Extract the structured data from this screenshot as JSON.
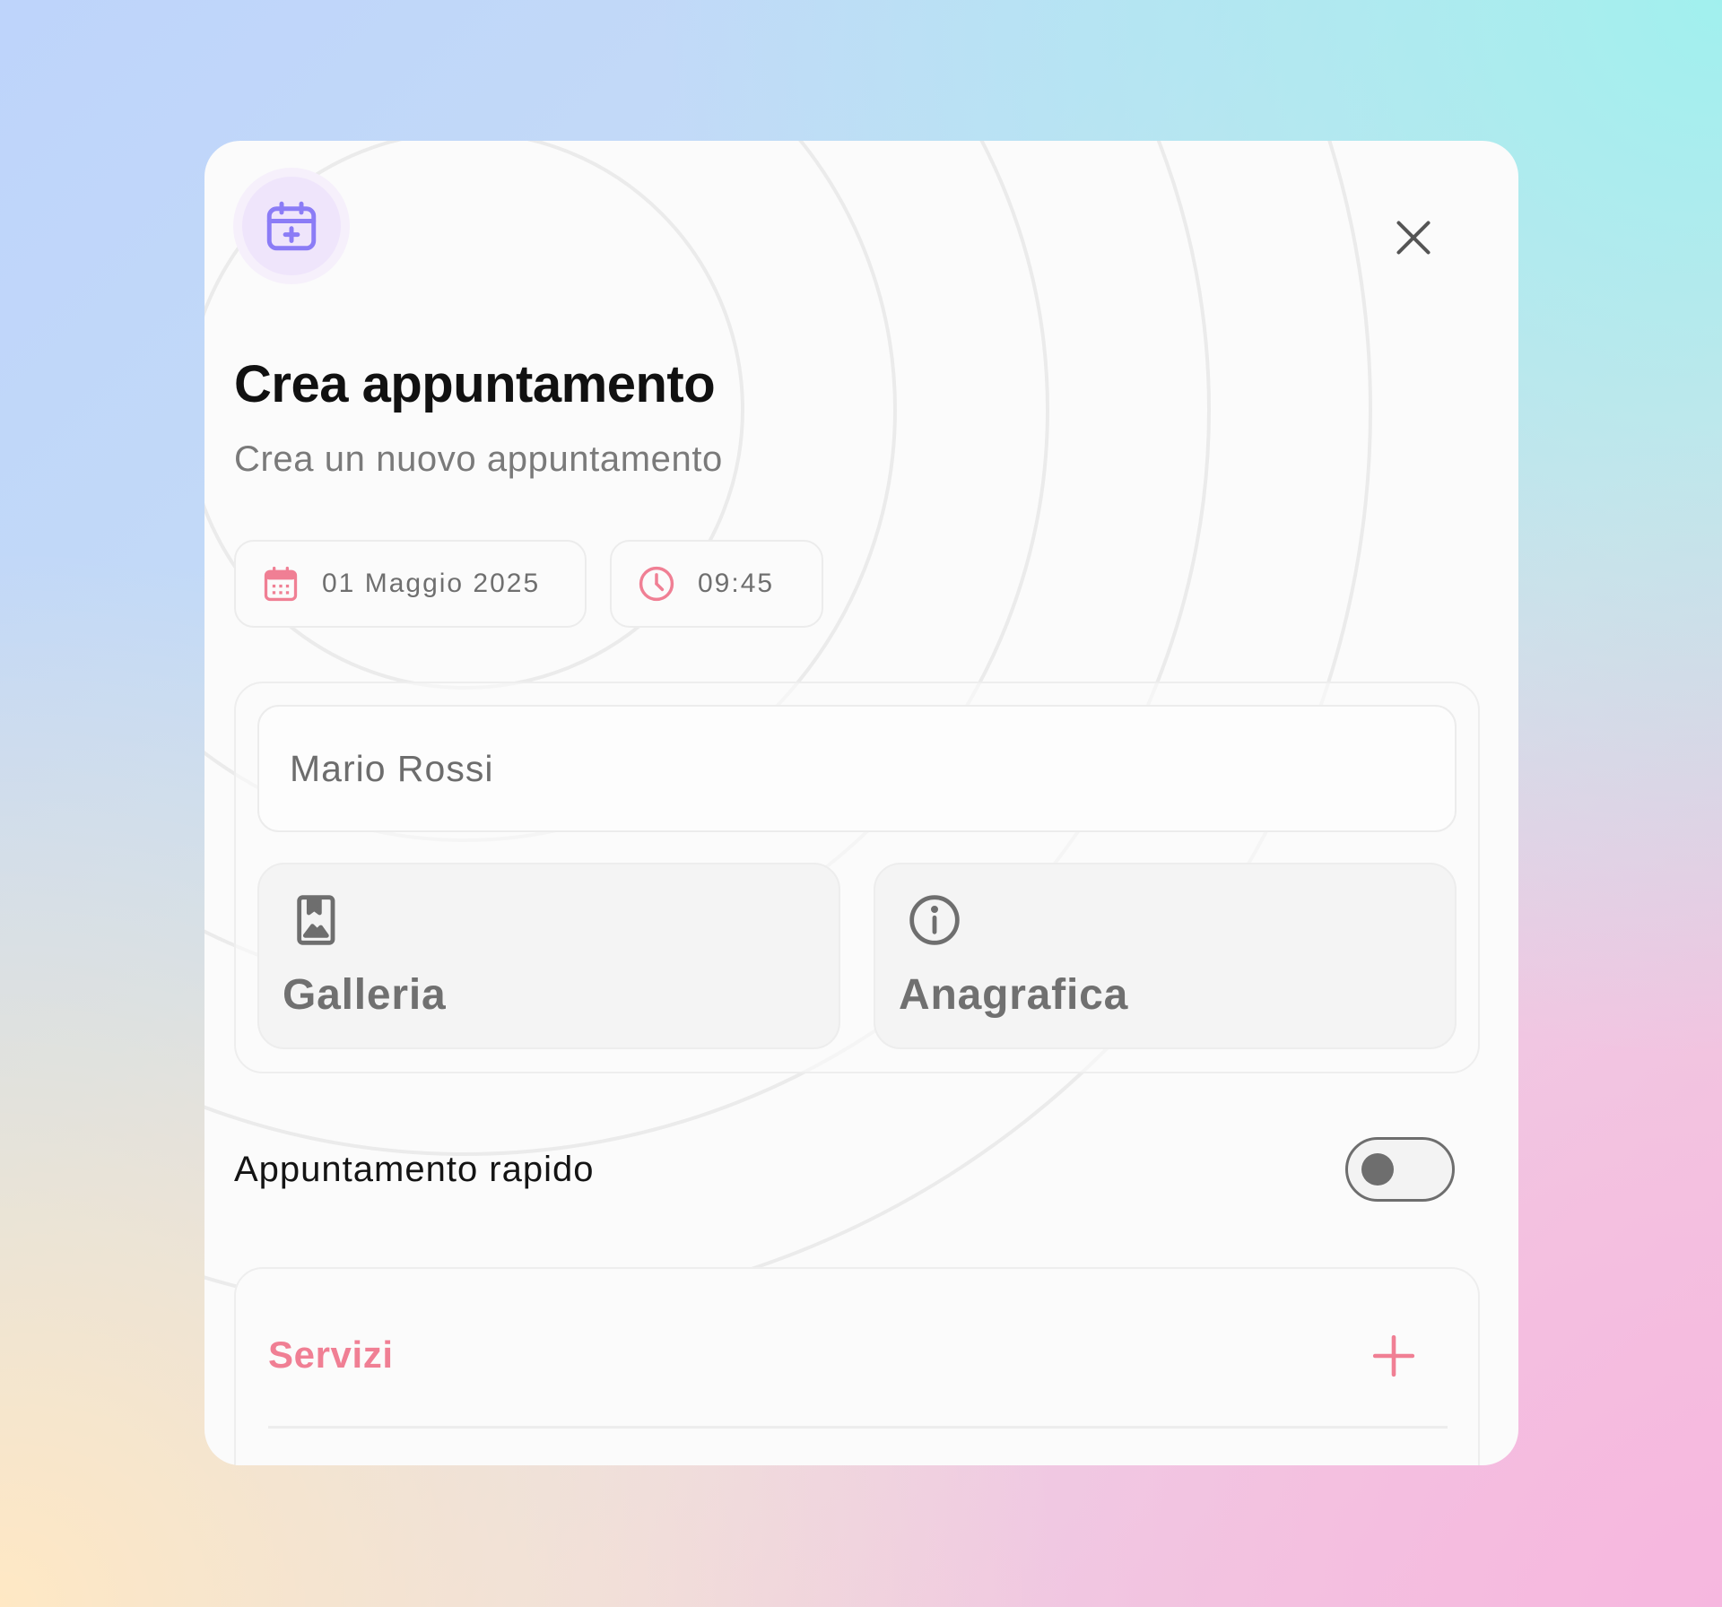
{
  "dialog": {
    "title": "Crea appuntamento",
    "subtitle": "Crea un nuovo appuntamento",
    "header_icon": "calendar-plus-icon",
    "close_icon": "close-icon"
  },
  "schedule": {
    "date": "01 Maggio 2025",
    "date_icon": "calendar-icon",
    "time": "09:45",
    "time_icon": "clock-icon"
  },
  "client": {
    "name": "Mario Rossi",
    "tiles": [
      {
        "label": "Galleria",
        "icon": "gallery-icon"
      },
      {
        "label": "Anagrafica",
        "icon": "info-icon"
      }
    ]
  },
  "quick_appointment": {
    "label": "Appuntamento rapido",
    "enabled": false
  },
  "services": {
    "label": "Servizi",
    "add_icon": "plus-icon"
  },
  "colors": {
    "accent_pink": "#f07f94",
    "accent_purple": "#8b7cf6",
    "header_icon_bg": "#efe5fb",
    "text_primary": "#111111",
    "text_secondary": "#7a7a7a"
  }
}
